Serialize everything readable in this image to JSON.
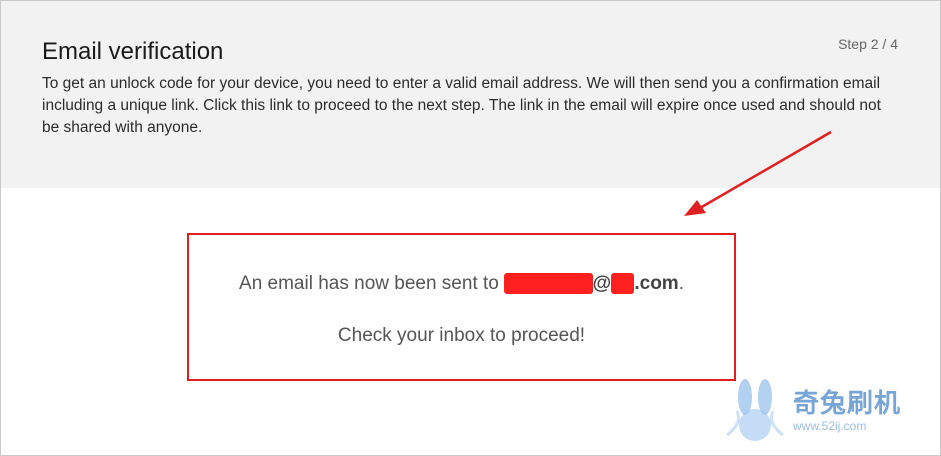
{
  "header": {
    "title": "Email verification",
    "step": "Step 2 / 4",
    "description": "To get an unlock code for your device, you need to enter a valid email address. We will then send you a confirmation email including a unique link. Click this link to proceed to the next step. The link in the email will expire once used and should not be shared with anyone."
  },
  "message": {
    "sent_prefix": "An email has now been sent to ",
    "email_at": "@",
    "email_domain_suffix": ".com",
    "sent_suffix": ".",
    "proceed": "Check your inbox to proceed!"
  },
  "watermark": {
    "brand": "奇兔刷机",
    "url": "www.52ij.com"
  },
  "colors": {
    "highlight": "#e02020",
    "header_bg": "#f2f2f2"
  }
}
